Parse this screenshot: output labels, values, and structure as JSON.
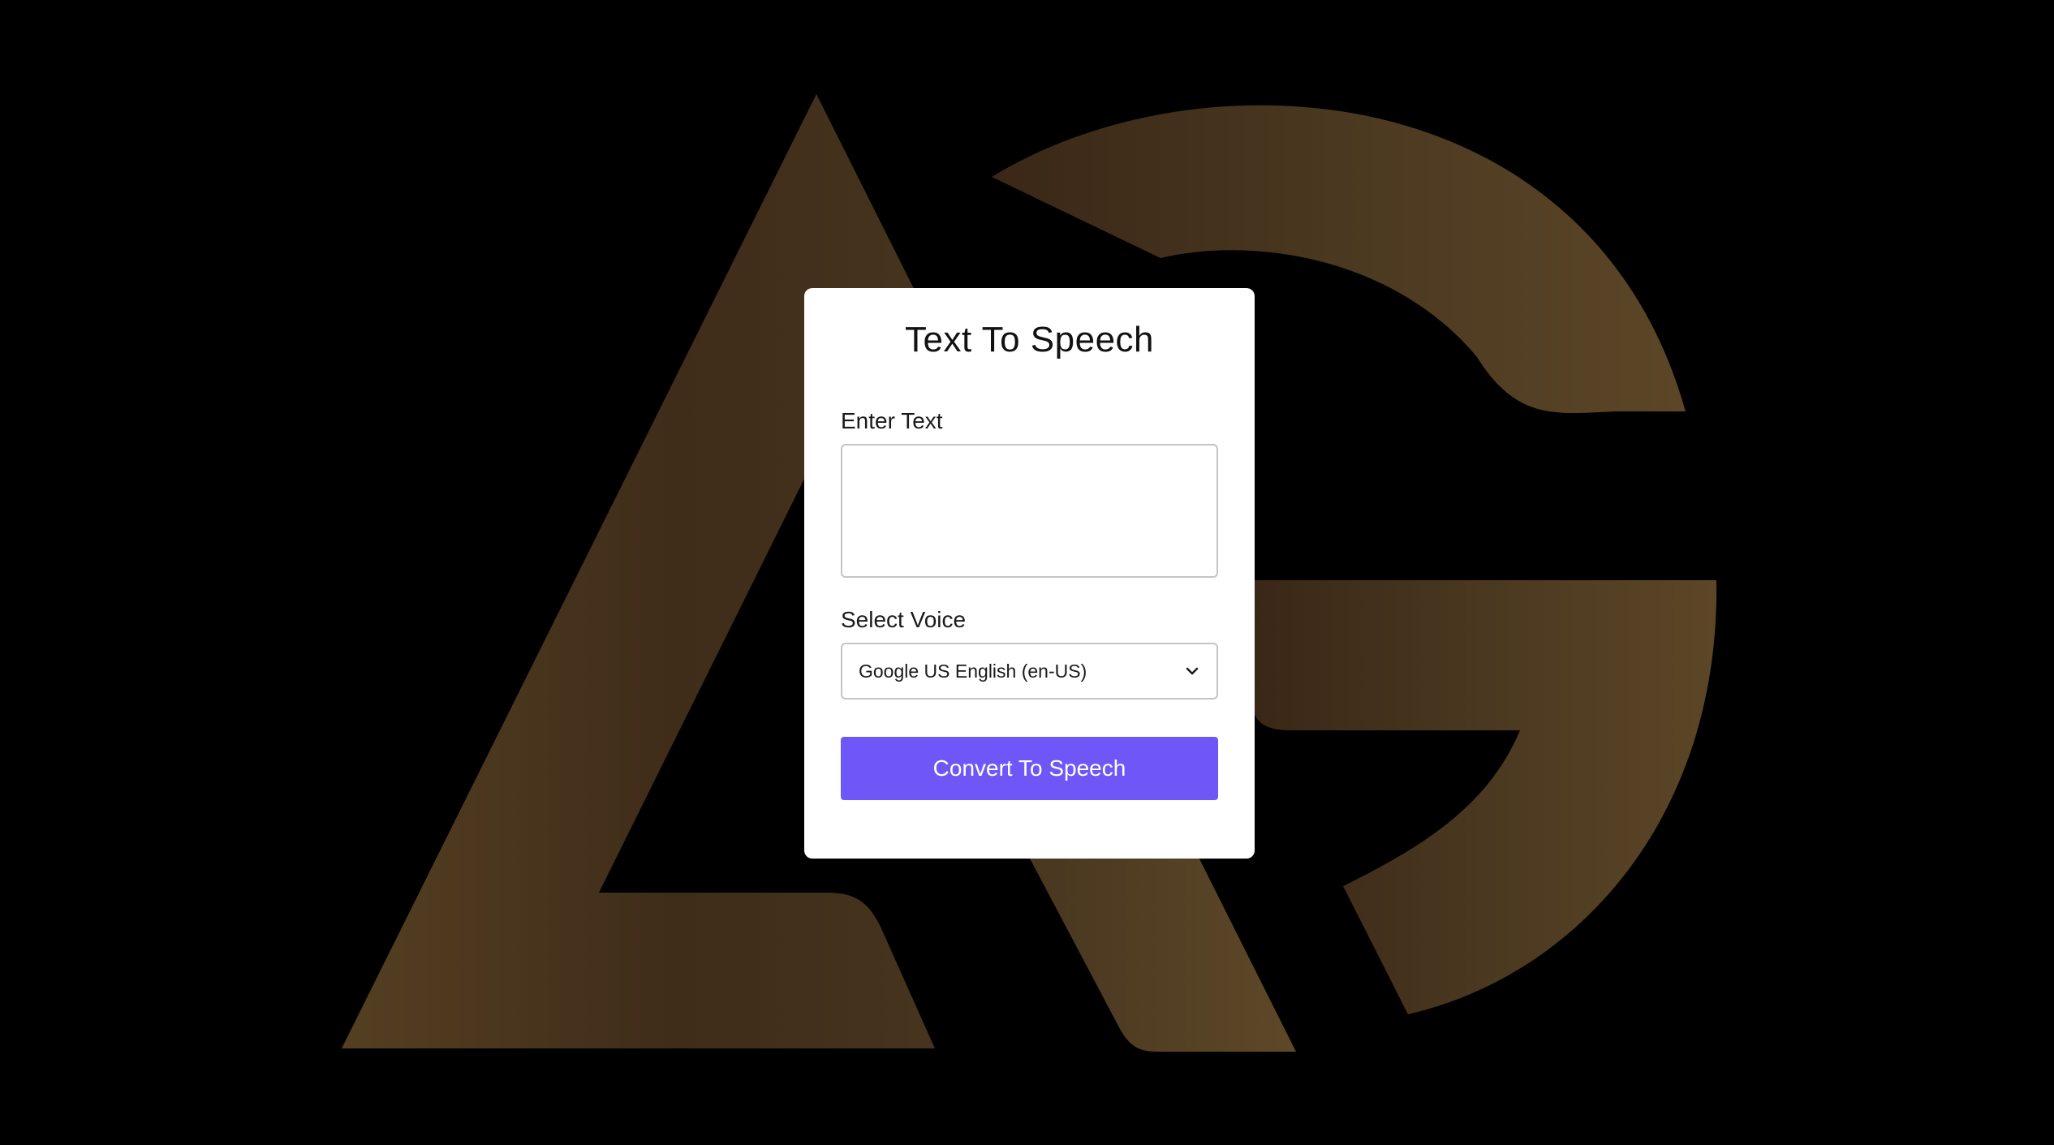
{
  "app": {
    "title": "Text To Speech"
  },
  "form": {
    "text_label": "Enter Text",
    "text_value": "",
    "text_placeholder": "",
    "voice_label": "Select Voice",
    "voice_selected": "Google US English (en-US)",
    "convert_label": "Convert To Speech"
  },
  "colors": {
    "background": "#000000",
    "logo_dark": "#3d2a18",
    "logo_light": "#5a4428",
    "card": "#ffffff",
    "button": "#6f57f7"
  },
  "icons": {
    "background_logo": "ag-logo",
    "select_chevron": "chevron-down-icon"
  }
}
